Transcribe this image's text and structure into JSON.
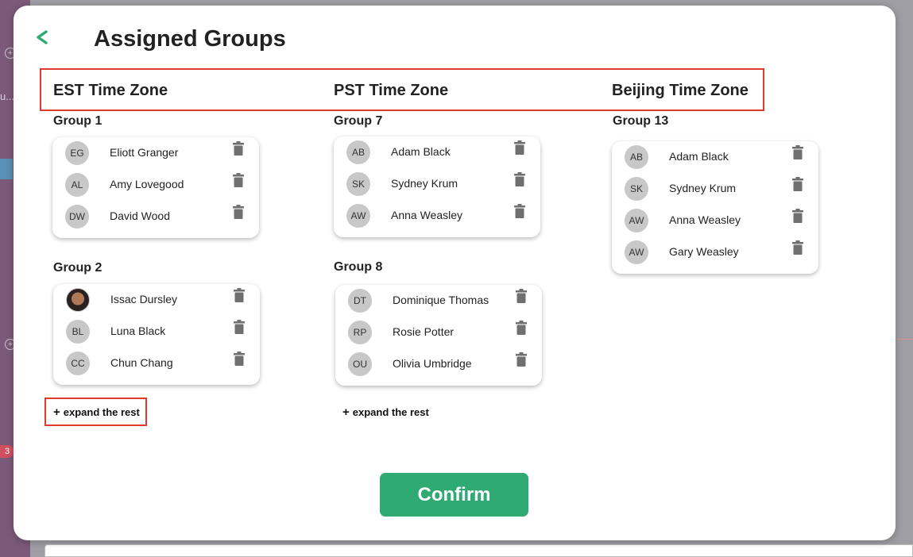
{
  "background": {
    "badge_count": "3",
    "truncated_text": "u..."
  },
  "modal": {
    "title": "Assigned Groups",
    "confirm_label": "Confirm",
    "expand_label": "expand the rest",
    "accent_color": "#2eaa72",
    "highlight_color": "#e03a2e"
  },
  "zones": [
    {
      "label": "EST Time Zone",
      "groups": [
        {
          "title": "Group 1",
          "members": [
            {
              "initials": "EG",
              "name": "Eliott Granger"
            },
            {
              "initials": "AL",
              "name": "Amy Lovegood"
            },
            {
              "initials": "DW",
              "name": "David Wood"
            }
          ]
        },
        {
          "title": "Group 2",
          "members": [
            {
              "initials": "",
              "name": "Issac Dursley",
              "avatar": "photo"
            },
            {
              "initials": "BL",
              "name": "Luna Black"
            },
            {
              "initials": "CC",
              "name": "Chun Chang"
            }
          ]
        }
      ]
    },
    {
      "label": "PST Time Zone",
      "groups": [
        {
          "title": "Group 7",
          "members": [
            {
              "initials": "AB",
              "name": "Adam Black"
            },
            {
              "initials": "SK",
              "name": "Sydney Krum"
            },
            {
              "initials": "AW",
              "name": "Anna Weasley"
            }
          ]
        },
        {
          "title": "Group 8",
          "members": [
            {
              "initials": "DT",
              "name": "Dominique Thomas"
            },
            {
              "initials": "RP",
              "name": "Rosie Potter"
            },
            {
              "initials": "OU",
              "name": "Olivia Umbridge"
            }
          ]
        }
      ]
    },
    {
      "label": "Beijing Time Zone",
      "groups": [
        {
          "title": "Group 13",
          "members": [
            {
              "initials": "AB",
              "name": "Adam Black"
            },
            {
              "initials": "SK",
              "name": "Sydney Krum"
            },
            {
              "initials": "AW",
              "name": "Anna Weasley"
            },
            {
              "initials": "AW",
              "name": "Gary Weasley"
            }
          ]
        }
      ]
    }
  ]
}
